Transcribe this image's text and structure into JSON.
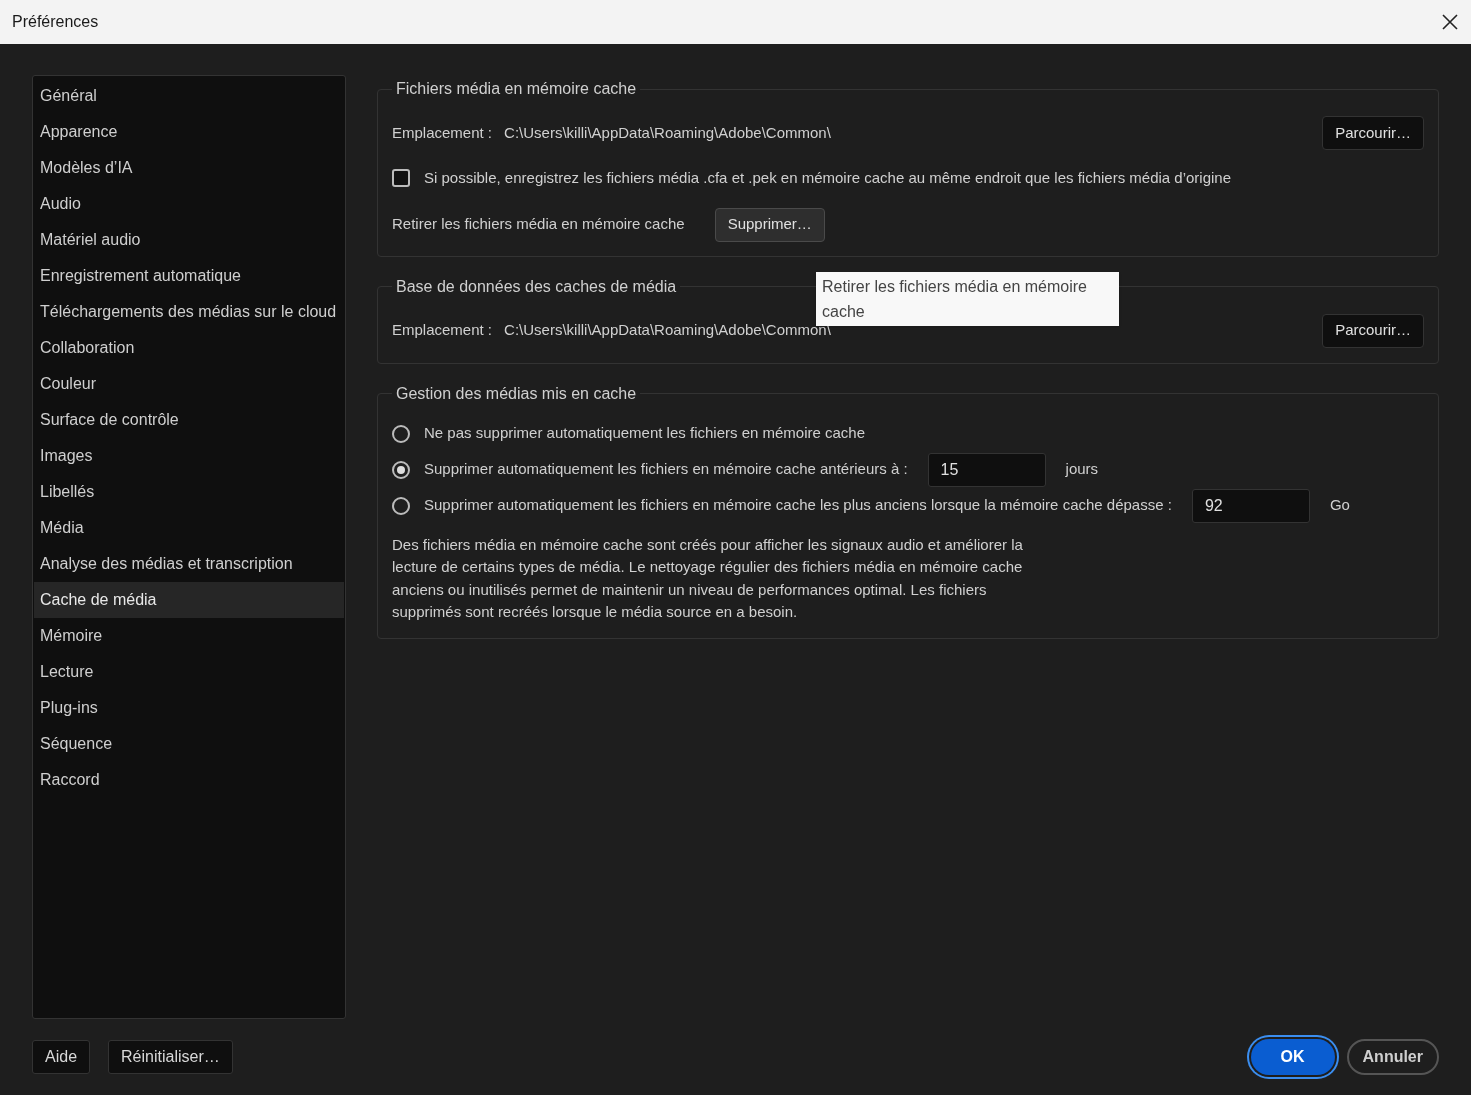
{
  "window": {
    "title": "Préférences"
  },
  "sidebar": {
    "items": [
      {
        "label": "Général",
        "selected": false
      },
      {
        "label": "Apparence",
        "selected": false
      },
      {
        "label": "Modèles d’IA",
        "selected": false
      },
      {
        "label": "Audio",
        "selected": false
      },
      {
        "label": "Matériel audio",
        "selected": false
      },
      {
        "label": "Enregistrement automatique",
        "selected": false
      },
      {
        "label": "Téléchargements des médias sur le cloud",
        "selected": false
      },
      {
        "label": "Collaboration",
        "selected": false
      },
      {
        "label": "Couleur",
        "selected": false
      },
      {
        "label": "Surface de contrôle",
        "selected": false
      },
      {
        "label": "Images",
        "selected": false
      },
      {
        "label": "Libellés",
        "selected": false
      },
      {
        "label": "Média",
        "selected": false
      },
      {
        "label": "Analyse des médias et transcription",
        "selected": false
      },
      {
        "label": "Cache de média",
        "selected": true
      },
      {
        "label": "Mémoire",
        "selected": false
      },
      {
        "label": "Lecture",
        "selected": false
      },
      {
        "label": "Plug-ins",
        "selected": false
      },
      {
        "label": "Séquence",
        "selected": false
      },
      {
        "label": "Raccord",
        "selected": false
      }
    ]
  },
  "media_cache_files": {
    "legend": "Fichiers média en mémoire cache",
    "location_label": "Emplacement :",
    "location_path": "C:\\Users\\killi\\AppData\\Roaming\\Adobe\\Common\\",
    "browse_button": "Parcourir…",
    "checkbox": {
      "label": "Si possible, enregistrez les fichiers média .cfa et .pek en mémoire cache au même endroit que les fichiers média d’origine",
      "checked": false
    },
    "remove_label": "Retirer les fichiers média en mémoire cache",
    "remove_button": "Supprimer…"
  },
  "tooltip": {
    "text": "Retirer les fichiers média en mémoire cache"
  },
  "media_cache_database": {
    "legend": "Base de données des caches de média",
    "location_label": "Emplacement :",
    "location_path": "C:\\Users\\killi\\AppData\\Roaming\\Adobe\\Common\\",
    "browse_button": "Parcourir…"
  },
  "cache_management": {
    "legend": "Gestion des médias mis en cache",
    "options": [
      {
        "kind": "plain",
        "label": "Ne pas supprimer automatiquement les fichiers en mémoire cache",
        "selected": false
      },
      {
        "kind": "field",
        "label": "Supprimer automatiquement les fichiers en mémoire cache antérieurs à :",
        "selected": true,
        "value": "15",
        "unit": "jours"
      },
      {
        "kind": "field",
        "label": "Supprimer automatiquement les fichiers en mémoire cache les plus anciens lorsque la mémoire cache dépasse :",
        "selected": false,
        "value": "92",
        "unit": "Go"
      }
    ],
    "description": "Des fichiers média en mémoire cache sont créés pour afficher les signaux audio et améliorer la lecture de certains types de média. Le nettoyage régulier des fichiers média en mémoire cache anciens ou inutilisés permet de maintenir un niveau de performances optimal. Les fichiers supprimés sont recréés lorsque le média source en a besoin."
  },
  "footer": {
    "left_buttons": [
      "Aide",
      "Réinitialiser…"
    ],
    "right_buttons": [
      {
        "kind": "primary",
        "label": "OK"
      },
      {
        "kind": "secondary",
        "label": "Annuler"
      }
    ]
  }
}
